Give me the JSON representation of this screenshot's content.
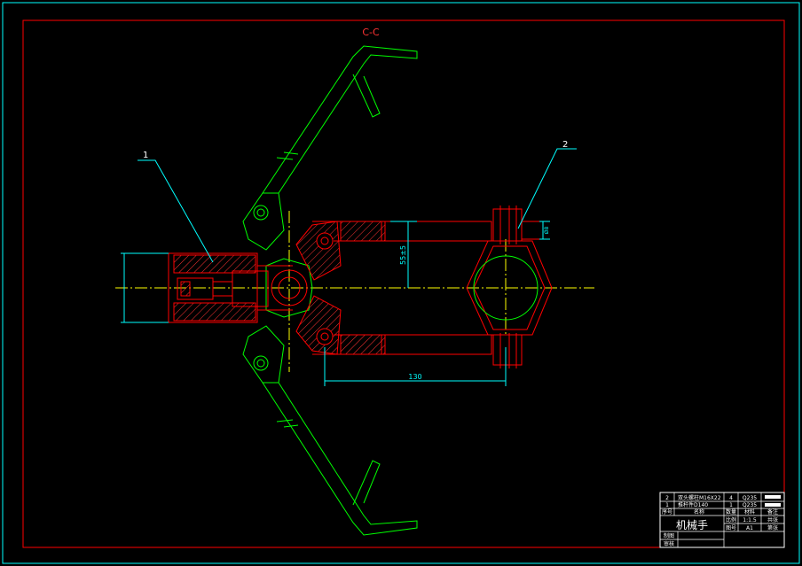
{
  "section_label": "C-C",
  "balloons": [
    {
      "num": "1"
    },
    {
      "num": "2"
    }
  ],
  "dimensions": {
    "vertical": "55±5",
    "horizontal": "130",
    "small": "Ø8"
  },
  "title_block": {
    "rows": [
      {
        "no": "2",
        "name": "双头螺柱M16X22",
        "qty": "4",
        "material": "Q235"
      },
      {
        "no": "1",
        "name": "推杆件D140",
        "qty": "1",
        "material": "Q235"
      }
    ],
    "header": {
      "no": "序号",
      "name": "名称",
      "qty": "数量",
      "material": "材料",
      "note": "备注"
    },
    "title": "机械手",
    "scale_label": "比例",
    "scale_value": "1:1.5",
    "sheet_label": "图号",
    "sheet_value": "A1",
    "extra_label": "共张",
    "extra_value": "第张",
    "designer_label": "制图",
    "checker_label": "审核"
  },
  "colors": {
    "frame": "#00FFFF",
    "border": "#FF0000",
    "part_red": "#FF0000",
    "part_green": "#00FF00",
    "center_line": "#FFFF00",
    "dim_line": "#00FFFF",
    "text_red": "#FF3333"
  }
}
